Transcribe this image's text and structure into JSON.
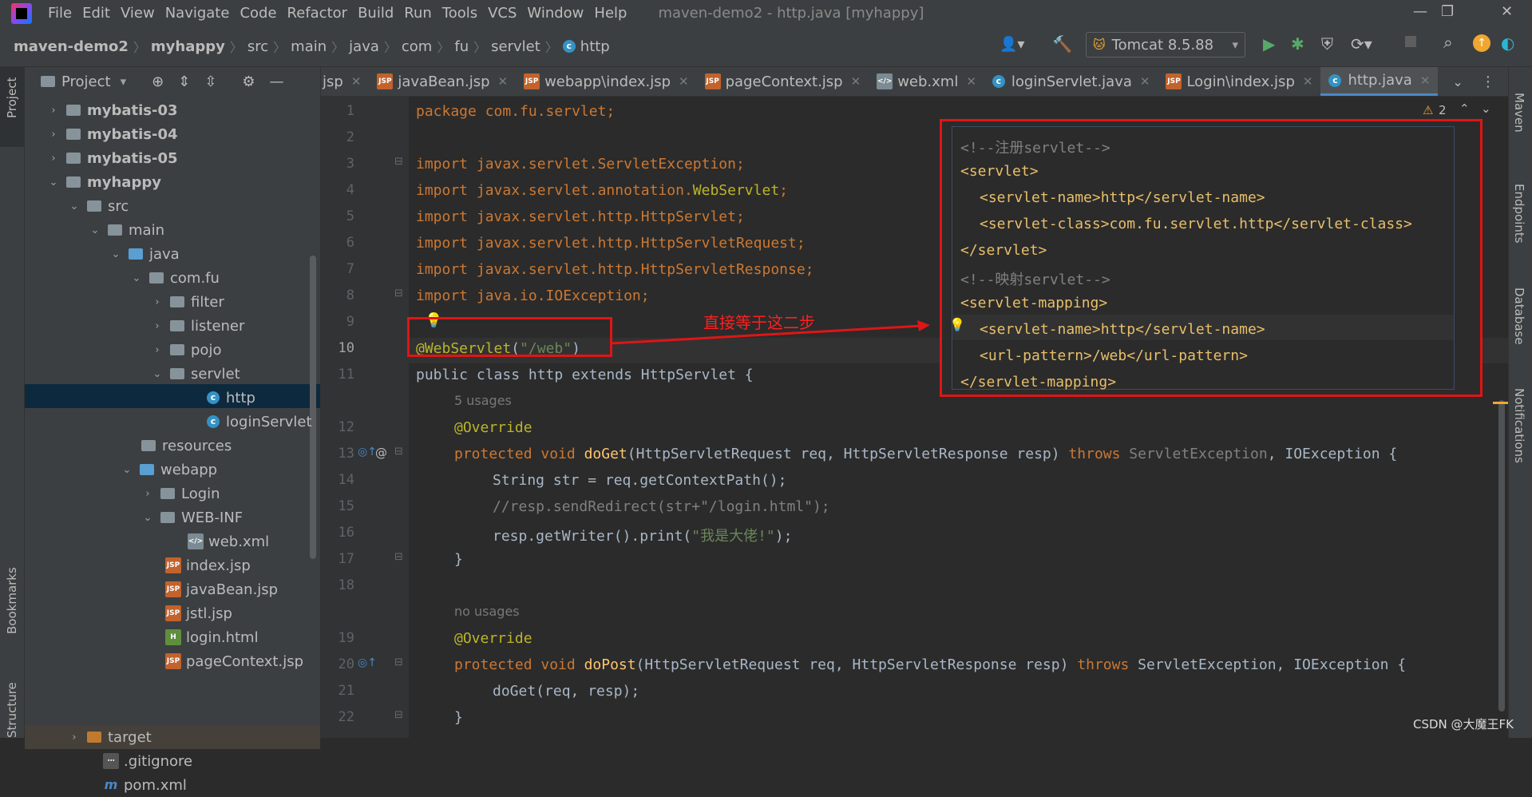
{
  "app": {
    "window_title": "maven-demo2 - http.java [myhappy]",
    "menu": [
      "File",
      "Edit",
      "View",
      "Navigate",
      "Code",
      "Refactor",
      "Build",
      "Run",
      "Tools",
      "VCS",
      "Window",
      "Help"
    ]
  },
  "breadcrumb": [
    "maven-demo2",
    "myhappy",
    "src",
    "main",
    "java",
    "com",
    "fu",
    "servlet",
    "http"
  ],
  "toolbar": {
    "run_config": "Tomcat 8.5.88"
  },
  "left_stripe": {
    "project": "Project",
    "bookmarks": "Bookmarks",
    "structure": "Structure"
  },
  "right_stripe": {
    "maven": "Maven",
    "endpoints": "Endpoints",
    "database": "Database",
    "notifications": "Notifications"
  },
  "project_panel": {
    "title": "Project",
    "tree": [
      {
        "label": "mybatis-03",
        "bold": true,
        "arrow": "›"
      },
      {
        "label": "mybatis-04",
        "bold": true,
        "arrow": "›"
      },
      {
        "label": "mybatis-05",
        "bold": true,
        "arrow": "›"
      },
      {
        "label": "myhappy",
        "bold": true,
        "arrow": "⌄"
      },
      {
        "label": "src",
        "arrow": "⌄"
      },
      {
        "label": "main",
        "arrow": "⌄"
      },
      {
        "label": "java",
        "arrow": "⌄"
      },
      {
        "label": "com.fu",
        "arrow": "⌄"
      },
      {
        "label": "filter",
        "arrow": "›"
      },
      {
        "label": "listener",
        "arrow": "›"
      },
      {
        "label": "pojo",
        "arrow": "›"
      },
      {
        "label": "servlet",
        "arrow": "⌄"
      },
      {
        "label": "http"
      },
      {
        "label": "loginServlet"
      },
      {
        "label": "resources"
      },
      {
        "label": "webapp",
        "arrow": "⌄"
      },
      {
        "label": "Login",
        "arrow": "›"
      },
      {
        "label": "WEB-INF",
        "arrow": "⌄"
      },
      {
        "label": "web.xml"
      },
      {
        "label": "index.jsp"
      },
      {
        "label": "javaBean.jsp"
      },
      {
        "label": "jstl.jsp"
      },
      {
        "label": "login.html"
      },
      {
        "label": "pageContext.jsp"
      },
      {
        "label": "target",
        "arrow": "›"
      },
      {
        "label": ".gitignore"
      },
      {
        "label": "pom.xml"
      }
    ]
  },
  "tabs": [
    {
      "label": "jsp"
    },
    {
      "label": "javaBean.jsp"
    },
    {
      "label": "webapp\\index.jsp"
    },
    {
      "label": "pageContext.jsp"
    },
    {
      "label": "web.xml"
    },
    {
      "label": "loginServlet.java"
    },
    {
      "label": "Login\\index.jsp"
    },
    {
      "label": "http.java",
      "active": true
    }
  ],
  "editor": {
    "warning_count": "2",
    "line_numbers": [
      "1",
      "2",
      "3",
      "4",
      "5",
      "6",
      "7",
      "8",
      "9",
      "10",
      "11",
      "12",
      "13",
      "14",
      "15",
      "16",
      "17",
      "18",
      "19",
      "20",
      "21",
      "22"
    ],
    "lines": {
      "l1": "package com.fu.servlet;",
      "l3": "import javax.servlet.ServletException;",
      "l4a": "import javax.servlet.annotation.",
      "l4b": "WebServlet",
      "l4c": ";",
      "l5": "import javax.servlet.http.HttpServlet;",
      "l6": "import javax.servlet.http.HttpServletRequest;",
      "l7": "import javax.servlet.http.HttpServletResponse;",
      "l8": "import java.io.IOException;",
      "l10a": "@WebServlet",
      "l10b": "(",
      "l10c": "\"/web\"",
      "l10d": ")",
      "l11": "public class http extends HttpServlet {",
      "u1": "5 usages",
      "l12": "@Override",
      "l13a": "protected void ",
      "l13b": "doGet",
      "l13c": "(HttpServletRequest req, HttpServletResponse resp) ",
      "l13d": "throws ",
      "l13e": "ServletException",
      "l13f": ", IOException {",
      "l14": "String str = req.getContextPath();",
      "l15": "//resp.sendRedirect(str+\"/login.html\");",
      "l16a": "resp.getWriter().print(",
      "l16b": "\"我是大佬!\"",
      "l16c": ");",
      "l17": "}",
      "u2": "no usages",
      "l19": "@Override",
      "l20a": "protected void ",
      "l20b": "doPost",
      "l20c": "(HttpServletRequest req, HttpServletResponse resp) ",
      "l20d": "throws ",
      "l20e": "ServletException, IOException {",
      "l21": "doGet(req, resp);",
      "l22": "}"
    }
  },
  "xml_popup": {
    "lines": [
      "<!--注册servlet-->",
      "<servlet>",
      "<servlet-name>http</servlet-name>",
      "<servlet-class>com.fu.servlet.http</servlet-class>",
      "</servlet>",
      "<!--映射servlet-->",
      "<servlet-mapping>",
      "<servlet-name>http</servlet-name>",
      "<url-pattern>/web</url-pattern>",
      "</servlet-mapping>"
    ]
  },
  "annotation": {
    "label": "直接等于这二步"
  },
  "watermark": "CSDN @大魔王FK",
  "colors": {
    "keyword": "#cc7832",
    "annotation": "#bbb529",
    "string": "#6a8759",
    "highlight_red": "#e01515",
    "tag": "#e8bf6a"
  }
}
